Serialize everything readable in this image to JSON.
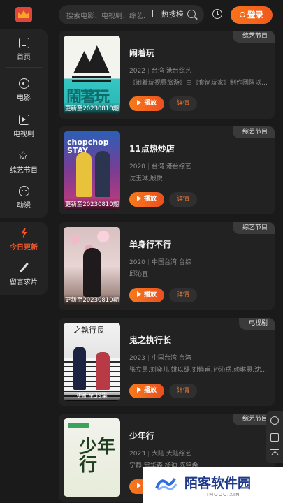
{
  "search": {
    "placeholder": "搜索电影、电视剧、综艺...",
    "hot_label": "热搜榜"
  },
  "header": {
    "login_label": "登录"
  },
  "sidebar": {
    "items": [
      {
        "label": "首页",
        "icon": "home-icon"
      },
      {
        "label": "电影",
        "icon": "movie-icon"
      },
      {
        "label": "电视剧",
        "icon": "tv-icon"
      },
      {
        "label": "综艺节目",
        "icon": "variety-icon"
      },
      {
        "label": "动漫",
        "icon": "anime-icon"
      }
    ],
    "extra": [
      {
        "label": "今日更新",
        "icon": "lightning-icon",
        "active": true
      },
      {
        "label": "留言求片",
        "icon": "pen-icon"
      }
    ]
  },
  "cards": [
    {
      "tag": "综艺节目",
      "title": "闹着玩",
      "year": "2022",
      "region": "台湾 港台综艺",
      "desc": "《闹着玩视界旅游》由《食尚玩家》制作团队以及…",
      "update": "更新至20230810期",
      "play": "播放",
      "detail": "详情"
    },
    {
      "tag": "综艺节目",
      "title": "11点热炒店",
      "year": "2020",
      "region": "台湾 港台综艺",
      "desc": "沈玉琳,殷悦",
      "update": "更新至20230810期",
      "play": "播放",
      "detail": "详情",
      "poster_text": "chopchop STAY"
    },
    {
      "tag": "综艺节目",
      "title": "单身行不行",
      "year": "2020",
      "region": "中国台湾 台综",
      "desc": "邱沁宜",
      "update": "更新至20230810期",
      "play": "播放",
      "detail": "详情"
    },
    {
      "tag": "电视剧",
      "title": "鬼之执行长",
      "year": "2023",
      "region": "中国台湾 台湾",
      "desc": "张立昂,刘奕儿,姚以缇,刘修甫,孙沁岳,赖琳恩,沈孟…",
      "update": "更新至39集",
      "play": "播放",
      "detail": "详情",
      "poster_text": "之執行長"
    },
    {
      "tag": "综艺节目",
      "title": "少年行",
      "year": "2023",
      "region": "大陆 大陆综艺",
      "desc": "宁静,常华森,杨迪,陈铭希",
      "update": "",
      "play": "播放",
      "detail": "详情",
      "poster_text": "少年行"
    }
  ],
  "watermark": {
    "name": "陌客软件园",
    "domain": "IMOOC.XIN"
  },
  "colors": {
    "accent": "#f0572a",
    "background": "#1a1a1a",
    "card": "#222222"
  }
}
